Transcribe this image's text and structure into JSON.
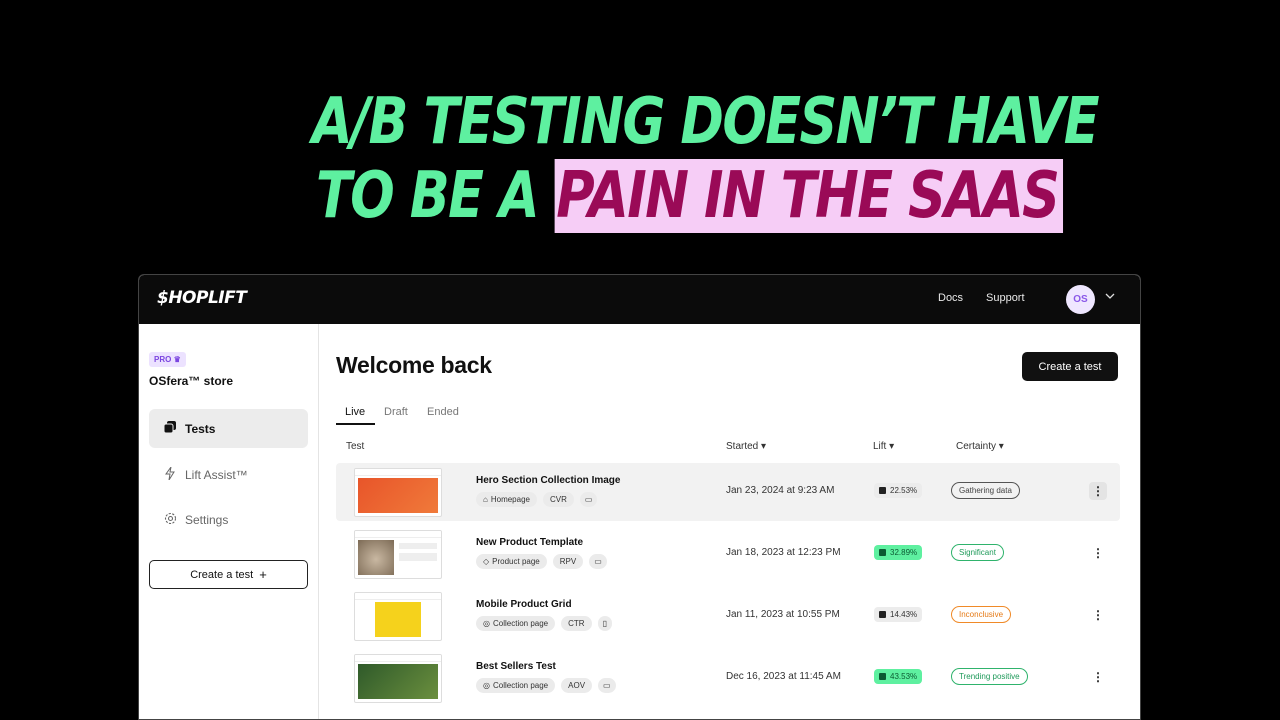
{
  "hero": {
    "line1": "A/B TESTING DOESN’T HAVE",
    "line2_prefix": "TO BE A ",
    "line2_highlight": "PAIN IN THE SAAS"
  },
  "topbar": {
    "logo": "$HOPLIFT",
    "docs": "Docs",
    "support": "Support",
    "avatar_initials": "OS",
    "icons": {
      "menu": "chevron-down-icon"
    }
  },
  "sidebar": {
    "badge": "PRO",
    "store": "OSfera™ store",
    "items": [
      {
        "label": "Tests",
        "icon": "tests-icon"
      },
      {
        "label": "Lift Assist™",
        "icon": "lightning-icon"
      },
      {
        "label": "Settings",
        "icon": "gear-icon"
      }
    ],
    "create": "Create a test"
  },
  "main": {
    "title": "Welcome back",
    "create": "Create a test",
    "tabs": [
      "Live",
      "Draft",
      "Ended"
    ],
    "columns": {
      "test": "Test",
      "started": "Started",
      "lift": "Lift",
      "certainty": "Certainty"
    },
    "rows": [
      {
        "name": "Hero Section Collection Image",
        "page": "Homepage",
        "metric": "CVR",
        "started": "Jan 23, 2024 at 9:23 AM",
        "lift": "22.53%",
        "certainty": "Gathering data"
      },
      {
        "name": "New Product Template",
        "page": "Product page",
        "metric": "RPV",
        "started": "Jan 18, 2023 at 12:23 PM",
        "lift": "32.89%",
        "certainty": "Significant"
      },
      {
        "name": "Mobile Product Grid",
        "page": "Collection page",
        "metric": "CTR",
        "started": "Jan 11, 2023 at 10:55 PM",
        "lift": "14.43%",
        "certainty": "Inconclusive"
      },
      {
        "name": "Best Sellers Test",
        "page": "Collection page",
        "metric": "AOV",
        "started": "Dec 16, 2023 at 11:45 AM",
        "lift": "43.53%",
        "certainty": "Trending positive"
      }
    ]
  },
  "colors": {
    "hero_green": "#5ef0a0",
    "highlight_bg": "#f6cdf6",
    "highlight_text": "#9a0a57",
    "pro_purple": "#7b45e0"
  }
}
